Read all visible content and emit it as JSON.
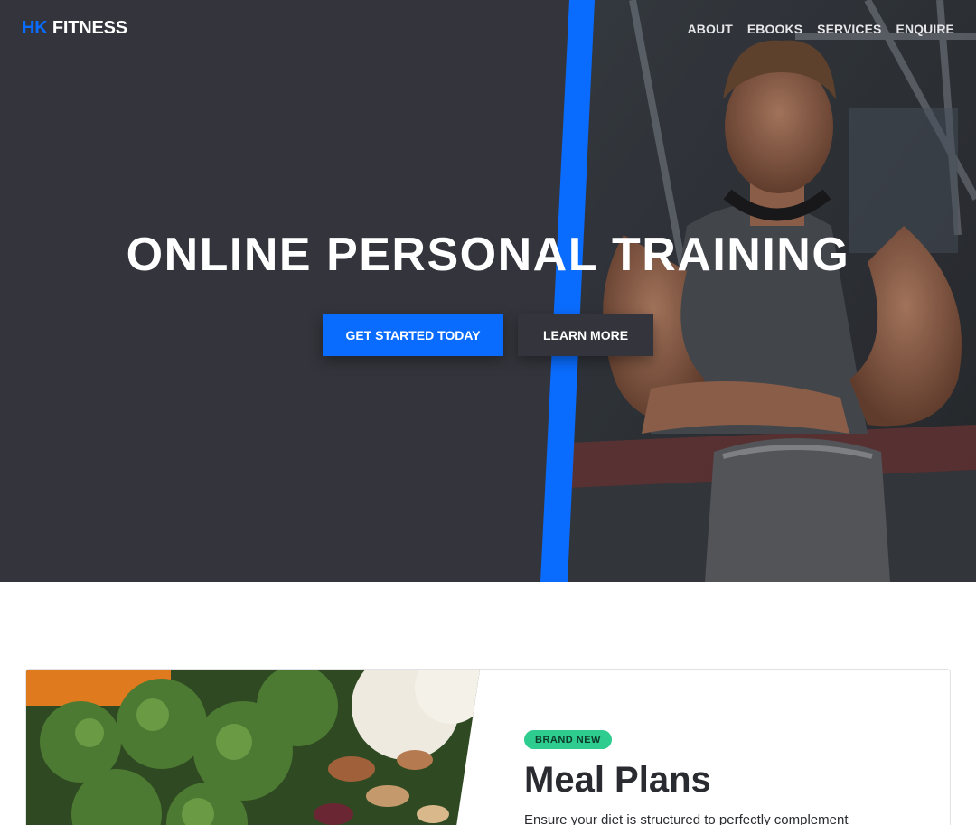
{
  "brand": {
    "accent": "HK",
    "name": "FITNESS"
  },
  "nav": [
    {
      "label": "ABOUT"
    },
    {
      "label": "EBOOKS"
    },
    {
      "label": "SERVICES"
    },
    {
      "label": "ENQUIRE"
    }
  ],
  "hero": {
    "title": "ONLINE PERSONAL TRAINING",
    "primary_button": "GET STARTED TODAY",
    "secondary_button": "LEARN MORE"
  },
  "feature": {
    "badge": "BRAND NEW",
    "title": "Meal Plans",
    "text": "Ensure your diet is structured to perfectly complement"
  },
  "colors": {
    "accent": "#0a6cff",
    "hero_bg": "#34353c",
    "badge_bg": "#2ecc8f",
    "text_dark": "#2a2b30"
  },
  "icons": {
    "hero_photo": "athlete-photo",
    "card_photo": "vegetables-photo"
  }
}
